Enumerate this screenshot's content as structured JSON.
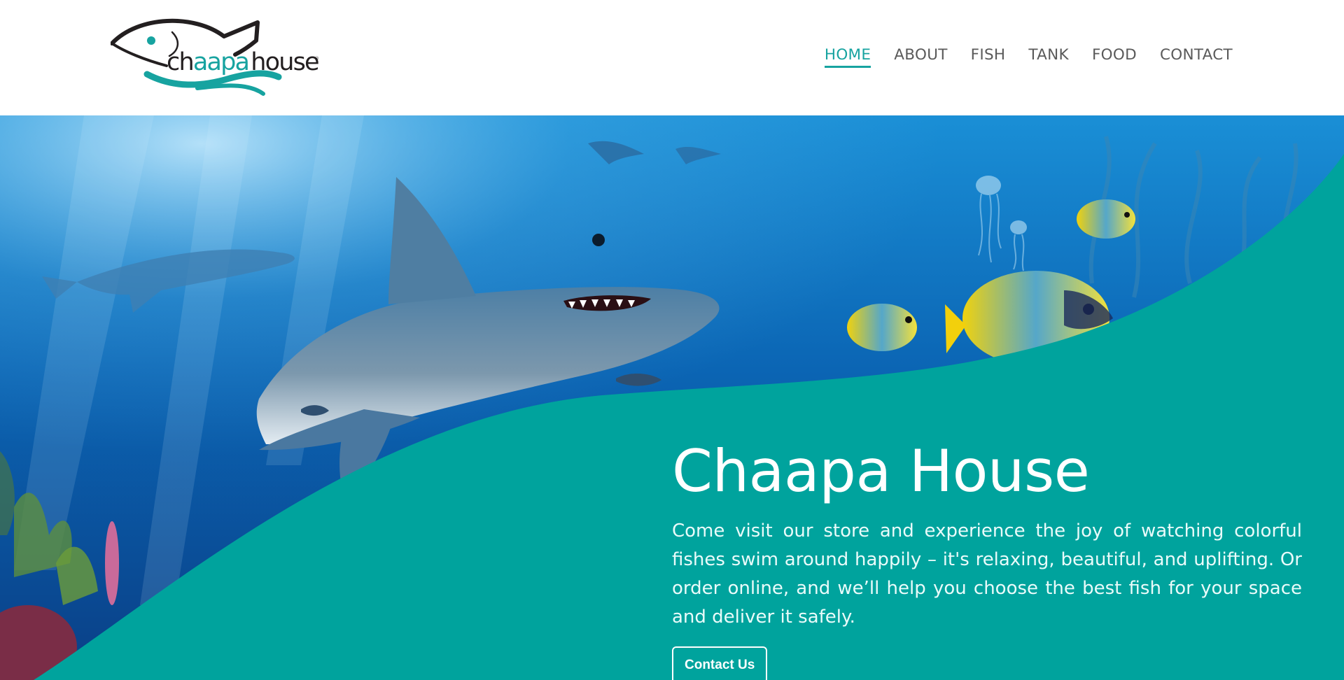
{
  "brand": {
    "logo_text_prefix": "ch",
    "logo_text_accent": "aapa",
    "logo_text_suffix": "house",
    "logo_mark": "®",
    "colors": {
      "teal": "#17a3a0",
      "dark": "#231f20"
    }
  },
  "nav": {
    "items": [
      {
        "label": "HOME",
        "active": true
      },
      {
        "label": "ABOUT",
        "active": false
      },
      {
        "label": "FISH",
        "active": false
      },
      {
        "label": "TANK",
        "active": false
      },
      {
        "label": "FOOD",
        "active": false
      },
      {
        "label": "CONTACT",
        "active": false
      }
    ]
  },
  "hero": {
    "title": "Chaapa House",
    "description": "Come visit our store and experience the joy of watching colorful fishes swim around happily – it's relaxing, beautiful, and uplifting. Or order online, and we’ll help you choose the best fish for your space and deliver it safely.",
    "cta_label": "Contact Us",
    "background_description_icon": "underwater-shark-illustration",
    "colors": {
      "panel": "#00a39d",
      "ocean": "#0a5ea8"
    }
  }
}
